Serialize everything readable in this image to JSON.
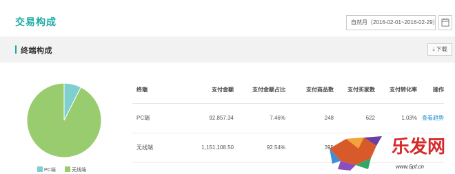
{
  "header": {
    "title": "交易构成"
  },
  "date_range": {
    "text": "自然月（2016-02-01~2016-02-29）",
    "calendar_icon": "calendar-icon"
  },
  "section": {
    "title": "终端构成",
    "download_label": "下载",
    "download_icon": "download-icon"
  },
  "chart_data": {
    "type": "pie",
    "categories": [
      "PC端",
      "无线端"
    ],
    "values": [
      7.46,
      92.54
    ],
    "colors": [
      "#7fcfcf",
      "#99cc6f"
    ]
  },
  "legend": [
    {
      "label": "PC端",
      "color": "#7fcfcf"
    },
    {
      "label": "无线端",
      "color": "#99cc6f"
    }
  ],
  "table": {
    "headers": [
      "终端",
      "支付金额",
      "支付金额占比",
      "支付商品数",
      "支付买家数",
      "支付转化率",
      "操作"
    ],
    "rows": [
      [
        "PC端",
        "92,857.34",
        "7.46%",
        "248",
        "622",
        "1.03%",
        "查看趋势"
      ],
      [
        "无线端",
        "1,151,108.50",
        "92.54%",
        "395",
        "",
        "",
        ""
      ]
    ]
  },
  "watermark": {
    "brand": "乐发网",
    "url": "www.6pf.cn"
  }
}
